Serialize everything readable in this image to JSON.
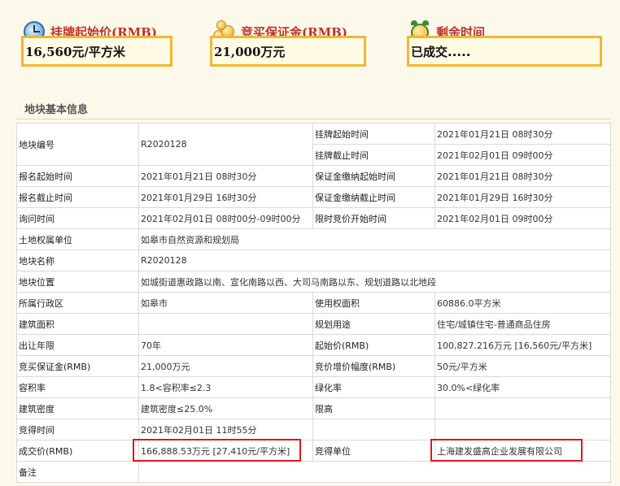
{
  "summary": {
    "start_price_label": "挂牌起始价(RMB)",
    "start_price_value": "16,560元/平方米",
    "deposit_label": "竞买保证金(RMB)",
    "deposit_value": "21,000万元",
    "time_label": "剩余时间",
    "time_value": "已成交.....",
    "icons": [
      "clock-icon",
      "coins-icon",
      "alarm-clock-icon"
    ]
  },
  "section_title": "地块基本信息",
  "table": {
    "r1": {
      "l1": "地块编号",
      "v1": "R2020128",
      "l2": "挂牌起始时间",
      "v2": "2021年01月21日 08时30分"
    },
    "r2": {
      "l2": "挂牌截止时间",
      "v2": "2021年02月01日 09时00分"
    },
    "r3": {
      "l1": "报名起始时间",
      "v1": "2021年01月21日 08时30分",
      "l2": "保证金缴纳起始时间",
      "v2": "2021年01月21日 08时30分"
    },
    "r4": {
      "l1": "报名截止时间",
      "v1": "2021年01月29日 16时30分",
      "l2": "保证金缴纳截止时间",
      "v2": "2021年01月29日 16时30分"
    },
    "r5": {
      "l1": "询问时间",
      "v1": "2021年02月01日 08时00分-09时00分",
      "l2": "限时竞价开始时间",
      "v2": "2021年02月01日 09时00分"
    },
    "r6": {
      "l1": "土地权属单位",
      "v1": "如皋市自然资源和规划局"
    },
    "r7": {
      "l1": "地块名称",
      "v1": "R2020128"
    },
    "r8": {
      "l1": "地块位置",
      "v1": "如城街道惠政路以南、宣化南路以西、大司马南路以东、规划道路以北地段"
    },
    "r9": {
      "l1": "所属行政区",
      "v1": "如皋市",
      "l2": "使用权面积",
      "v2": "60886.0平方米"
    },
    "r10": {
      "l1": "建筑面积",
      "v1": "",
      "l2": "规划用途",
      "v2": "住宅/城镇住宅-普通商品住房"
    },
    "r11": {
      "l1": "出让年限",
      "v1": "70年",
      "l2": "起始价(RMB)",
      "v2": "100,827.216万元 [16,560元/平方米]"
    },
    "r12": {
      "l1": "竞买保证金(RMB)",
      "v1": "21,000万元",
      "l2": "竞价增价幅度(RMB)",
      "v2": "50元/平方米"
    },
    "r13": {
      "l1": "容积率",
      "v1": "1.8<容积率≤2.3",
      "l2": "绿化率",
      "v2": "30.0%<绿化率"
    },
    "r14": {
      "l1": "建筑密度",
      "v1": "建筑密度≤25.0%",
      "l2": "限高",
      "v2": ""
    },
    "r15": {
      "l1": "竞得时间",
      "v1": "2021年02月01日 11时55分",
      "l2": "",
      "v2": ""
    },
    "r16": {
      "l1": "成交价(RMB)",
      "v1": "166,888.53万元 [27,410元/平方米]",
      "l2": "竞得单位",
      "v2": "上海建发盛高企业发展有限公司"
    },
    "r17": {
      "l1": "备注",
      "v1": ""
    }
  }
}
